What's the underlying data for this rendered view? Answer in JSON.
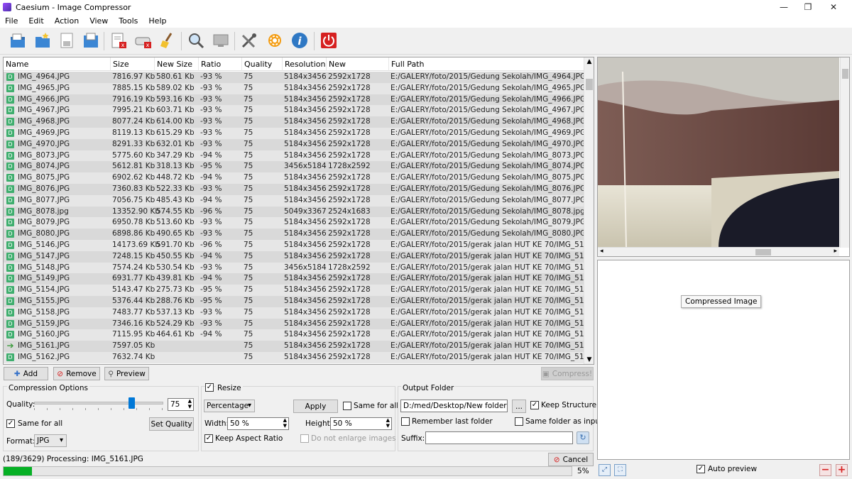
{
  "window": {
    "title": "Caesium - Image Compressor"
  },
  "menu": [
    "File",
    "Edit",
    "Action",
    "View",
    "Tools",
    "Help"
  ],
  "toolbar": {
    "icons": [
      "open-file-icon",
      "open-folder-icon",
      "save-icon",
      "save-all-icon",
      "remove-item-icon",
      "remove-all-icon",
      "clear-list-icon",
      "preview-icon",
      "compress-display-icon",
      "settings-icon",
      "options-gear-icon",
      "info-icon",
      "exit-icon"
    ]
  },
  "table": {
    "headers": [
      "Name",
      "Size",
      "New Size",
      "Ratio",
      "Quality",
      "Resolution",
      "New Resolution",
      "Full Path"
    ],
    "rows": [
      [
        "IMG_4964.JPG",
        "7816.97 Kb",
        "580.61 Kb",
        "-93 %",
        "75",
        "5184x3456",
        "2592x1728",
        "E:/GALERY/foto/2015/Gedung Sekolah/IMG_4964.JPG"
      ],
      [
        "IMG_4965.JPG",
        "7885.15 Kb",
        "589.02 Kb",
        "-93 %",
        "75",
        "5184x3456",
        "2592x1728",
        "E:/GALERY/foto/2015/Gedung Sekolah/IMG_4965.JPG"
      ],
      [
        "IMG_4966.JPG",
        "7916.19 Kb",
        "593.16 Kb",
        "-93 %",
        "75",
        "5184x3456",
        "2592x1728",
        "E:/GALERY/foto/2015/Gedung Sekolah/IMG_4966.JPG"
      ],
      [
        "IMG_4967.JPG",
        "7995.21 Kb",
        "603.71 Kb",
        "-93 %",
        "75",
        "5184x3456",
        "2592x1728",
        "E:/GALERY/foto/2015/Gedung Sekolah/IMG_4967.JPG"
      ],
      [
        "IMG_4968.JPG",
        "8077.24 Kb",
        "614.00 Kb",
        "-93 %",
        "75",
        "5184x3456",
        "2592x1728",
        "E:/GALERY/foto/2015/Gedung Sekolah/IMG_4968.JPG"
      ],
      [
        "IMG_4969.JPG",
        "8119.13 Kb",
        "615.29 Kb",
        "-93 %",
        "75",
        "5184x3456",
        "2592x1728",
        "E:/GALERY/foto/2015/Gedung Sekolah/IMG_4969.JPG"
      ],
      [
        "IMG_4970.JPG",
        "8291.33 Kb",
        "632.01 Kb",
        "-93 %",
        "75",
        "5184x3456",
        "2592x1728",
        "E:/GALERY/foto/2015/Gedung Sekolah/IMG_4970.JPG"
      ],
      [
        "IMG_8073.JPG",
        "5775.60 Kb",
        "347.29 Kb",
        "-94 %",
        "75",
        "5184x3456",
        "2592x1728",
        "E:/GALERY/foto/2015/Gedung Sekolah/IMG_8073.JPG"
      ],
      [
        "IMG_8074.JPG",
        "5612.81 Kb",
        "318.13 Kb",
        "-95 %",
        "75",
        "3456x5184",
        "1728x2592",
        "E:/GALERY/foto/2015/Gedung Sekolah/IMG_8074.JPG"
      ],
      [
        "IMG_8075.JPG",
        "6902.62 Kb",
        "448.72 Kb",
        "-94 %",
        "75",
        "5184x3456",
        "2592x1728",
        "E:/GALERY/foto/2015/Gedung Sekolah/IMG_8075.JPG"
      ],
      [
        "IMG_8076.JPG",
        "7360.83 Kb",
        "522.33 Kb",
        "-93 %",
        "75",
        "5184x3456",
        "2592x1728",
        "E:/GALERY/foto/2015/Gedung Sekolah/IMG_8076.JPG"
      ],
      [
        "IMG_8077.JPG",
        "7056.75 Kb",
        "485.43 Kb",
        "-94 %",
        "75",
        "5184x3456",
        "2592x1728",
        "E:/GALERY/foto/2015/Gedung Sekolah/IMG_8077.JPG"
      ],
      [
        "IMG_8078.jpg",
        "13352.90 Kb",
        "574.55 Kb",
        "-96 %",
        "75",
        "5049x3367",
        "2524x1683",
        "E:/GALERY/foto/2015/Gedung Sekolah/IMG_8078.jpg"
      ],
      [
        "IMG_8079.JPG",
        "6950.78 Kb",
        "513.60 Kb",
        "-93 %",
        "75",
        "5184x3456",
        "2592x1728",
        "E:/GALERY/foto/2015/Gedung Sekolah/IMG_8079.JPG"
      ],
      [
        "IMG_8080.JPG",
        "6898.86 Kb",
        "490.65 Kb",
        "-93 %",
        "75",
        "5184x3456",
        "2592x1728",
        "E:/GALERY/foto/2015/Gedung Sekolah/IMG_8080.JPG"
      ],
      [
        "IMG_5146.JPG",
        "14173.69 Kb",
        "591.70 Kb",
        "-96 %",
        "75",
        "5184x3456",
        "2592x1728",
        "E:/GALERY/foto/2015/gerak jalan HUT KE 70/IMG_5146.JPG"
      ],
      [
        "IMG_5147.JPG",
        "7248.15 Kb",
        "450.55 Kb",
        "-94 %",
        "75",
        "5184x3456",
        "2592x1728",
        "E:/GALERY/foto/2015/gerak jalan HUT KE 70/IMG_5147.JPG"
      ],
      [
        "IMG_5148.JPG",
        "7574.24 Kb",
        "530.54 Kb",
        "-93 %",
        "75",
        "3456x5184",
        "1728x2592",
        "E:/GALERY/foto/2015/gerak jalan HUT KE 70/IMG_5148.JPG"
      ],
      [
        "IMG_5149.JPG",
        "6931.77 Kb",
        "439.81 Kb",
        "-94 %",
        "75",
        "5184x3456",
        "2592x1728",
        "E:/GALERY/foto/2015/gerak jalan HUT KE 70/IMG_5149.JPG"
      ],
      [
        "IMG_5154.JPG",
        "5143.47 Kb",
        "275.73 Kb",
        "-95 %",
        "75",
        "5184x3456",
        "2592x1728",
        "E:/GALERY/foto/2015/gerak jalan HUT KE 70/IMG_5154.JPG"
      ],
      [
        "IMG_5155.JPG",
        "5376.44 Kb",
        "288.76 Kb",
        "-95 %",
        "75",
        "5184x3456",
        "2592x1728",
        "E:/GALERY/foto/2015/gerak jalan HUT KE 70/IMG_5155.JPG"
      ],
      [
        "IMG_5158.JPG",
        "7483.77 Kb",
        "537.13 Kb",
        "-93 %",
        "75",
        "5184x3456",
        "2592x1728",
        "E:/GALERY/foto/2015/gerak jalan HUT KE 70/IMG_5158.JPG"
      ],
      [
        "IMG_5159.JPG",
        "7346.16 Kb",
        "524.29 Kb",
        "-93 %",
        "75",
        "5184x3456",
        "2592x1728",
        "E:/GALERY/foto/2015/gerak jalan HUT KE 70/IMG_5159.JPG"
      ],
      [
        "IMG_5160.JPG",
        "7115.95 Kb",
        "464.61 Kb",
        "-94 %",
        "75",
        "5184x3456",
        "2592x1728",
        "E:/GALERY/foto/2015/gerak jalan HUT KE 70/IMG_5160.JPG"
      ],
      [
        "IMG_5161.JPG",
        "7597.05 Kb",
        "",
        "",
        "75",
        "5184x3456",
        "2592x1728",
        "E:/GALERY/foto/2015/gerak jalan HUT KE 70/IMG_5161.JPG"
      ],
      [
        "IMG_5162.JPG",
        "7632.74 Kb",
        "",
        "",
        "75",
        "5184x3456",
        "2592x1728",
        "E:/GALERY/foto/2015/gerak jalan HUT KE 70/IMG_5162.JPG"
      ]
    ],
    "processing_row": 24
  },
  "actions": {
    "add": "Add",
    "remove": "Remove",
    "preview": "Preview",
    "compress": "Compress!"
  },
  "compression": {
    "group_label": "Compression Options",
    "quality_label": "Quality:",
    "quality_value": "75",
    "quality_fraction": 0.75,
    "same_for_all": "Same for all",
    "set_quality": "Set Quality",
    "format_label": "Format:",
    "format_value": "JPG"
  },
  "resize": {
    "label": "Resize",
    "mode": "Percentage",
    "apply": "Apply",
    "same_for_all": "Same for all",
    "width_label": "Width:",
    "width_value": "50 %",
    "height_label": "Height:",
    "height_value": "50 %",
    "keep_aspect": "Keep Aspect Ratio",
    "no_enlarge": "Do not enlarge images"
  },
  "output": {
    "label": "Output Folder",
    "folder": "D:/med/Desktop/New folder",
    "browse": "...",
    "keep_structure": "Keep Structure",
    "remember": "Remember last folder",
    "same_as_input": "Same folder as input",
    "suffix_label": "Suffix:",
    "suffix_value": ""
  },
  "status": {
    "text": "(189/3629) Processing: IMG_5161.JPG",
    "cancel": "Cancel",
    "percent": "5%",
    "progress_fraction": 0.05
  },
  "preview": {
    "compressed_label": "Compressed Image",
    "auto_preview": "Auto preview"
  },
  "colors": {
    "accent": "#06b025",
    "title_blue": "#0078d7",
    "cancel_red": "#e03b3b"
  }
}
